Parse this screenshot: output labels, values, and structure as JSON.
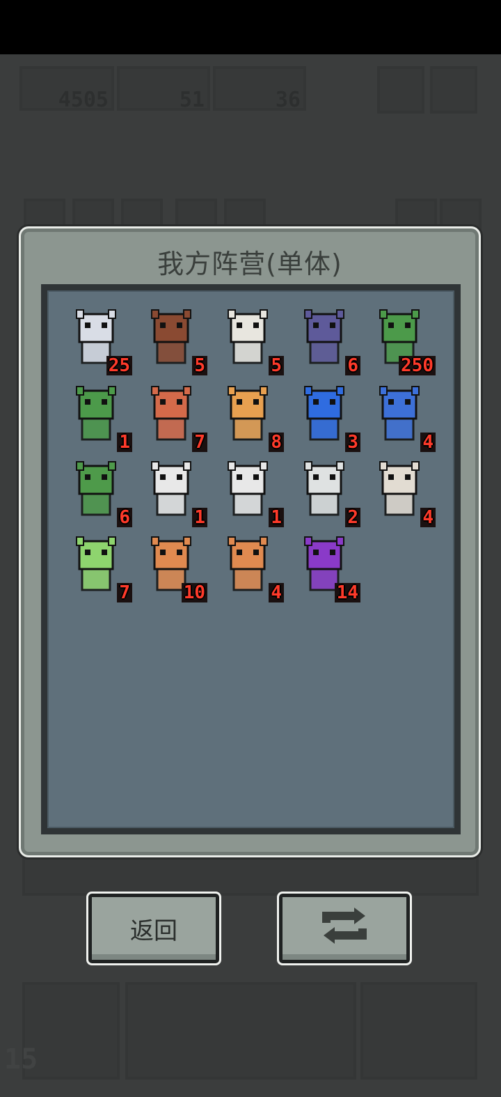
{
  "hud": {
    "resources": [
      {
        "icon": "feather-icon",
        "value": "4505"
      },
      {
        "icon": "monster-face-icon",
        "value": "51"
      },
      {
        "icon": "lightning-icon",
        "value": "36"
      }
    ],
    "turn": "15"
  },
  "panel": {
    "title": "我方阵营(单体)",
    "units": [
      {
        "icon": "white-haired-witch-icon",
        "level": "25",
        "color": "#d9dde6"
      },
      {
        "icon": "brown-rat-beast-icon",
        "level": "5",
        "color": "#8a4a32"
      },
      {
        "icon": "white-lion-priest-icon",
        "level": "5",
        "color": "#e8e6df"
      },
      {
        "icon": "purple-medusa-icon",
        "level": "6",
        "color": "#5e5a9a"
      },
      {
        "icon": "green-frog-knight-icon",
        "level": "250",
        "color": "#4c9a4a"
      },
      {
        "icon": "green-frog-knight-icon",
        "level": "1",
        "color": "#4c9a4a"
      },
      {
        "icon": "red-frog-knight-icon",
        "level": "7",
        "color": "#d46a4a"
      },
      {
        "icon": "orange-masked-cat-icon",
        "level": "8",
        "color": "#e8a050"
      },
      {
        "icon": "blue-clock-totem-icon",
        "level": "3",
        "color": "#2f6ce0"
      },
      {
        "icon": "blue-rune-totem-icon",
        "level": "4",
        "color": "#3d70d8"
      },
      {
        "icon": "green-goblin-icon",
        "level": "6",
        "color": "#4e9a4a"
      },
      {
        "icon": "white-skeleton-beast-icon",
        "level": "1",
        "color": "#e8e8e8"
      },
      {
        "icon": "white-skeleton-beast-icon",
        "level": "1",
        "color": "#e8e8e8"
      },
      {
        "icon": "white-cat-mage-icon",
        "level": "2",
        "color": "#dfe2e2"
      },
      {
        "icon": "white-ghoul-icon",
        "level": "4",
        "color": "#e2dcd2"
      },
      {
        "icon": "green-slime-icon",
        "level": "7",
        "color": "#8ed46e"
      },
      {
        "icon": "orange-spiky-star-icon",
        "level": "10",
        "color": "#e08a50"
      },
      {
        "icon": "orange-flame-shard-icon",
        "level": "4",
        "color": "#e08a50"
      },
      {
        "icon": "purple-dragon-icon",
        "level": "14",
        "color": "#8a3ac8"
      }
    ]
  },
  "buttons": {
    "back_label": "返回",
    "refresh_icon": "refresh-icon"
  }
}
